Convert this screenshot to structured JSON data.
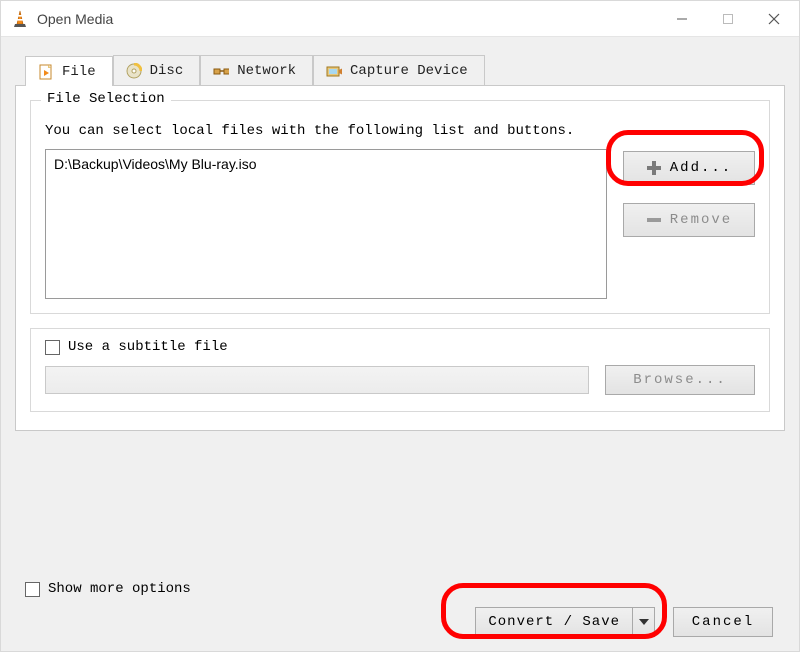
{
  "window": {
    "title": "Open Media"
  },
  "tabs": {
    "file": "File",
    "disc": "Disc",
    "network": "Network",
    "capture": "Capture Device"
  },
  "fileSelection": {
    "legend": "File Selection",
    "hint": "You can select local files with the following list and buttons.",
    "files": [
      "D:\\Backup\\Videos\\My Blu-ray.iso"
    ],
    "addLabel": "Add...",
    "removeLabel": "Remove"
  },
  "subtitle": {
    "checkboxLabel": "Use a subtitle file",
    "browseLabel": "Browse..."
  },
  "footer": {
    "showMoreLabel": "Show more options",
    "convertLabel": "Convert / Save",
    "cancelLabel": "Cancel"
  }
}
